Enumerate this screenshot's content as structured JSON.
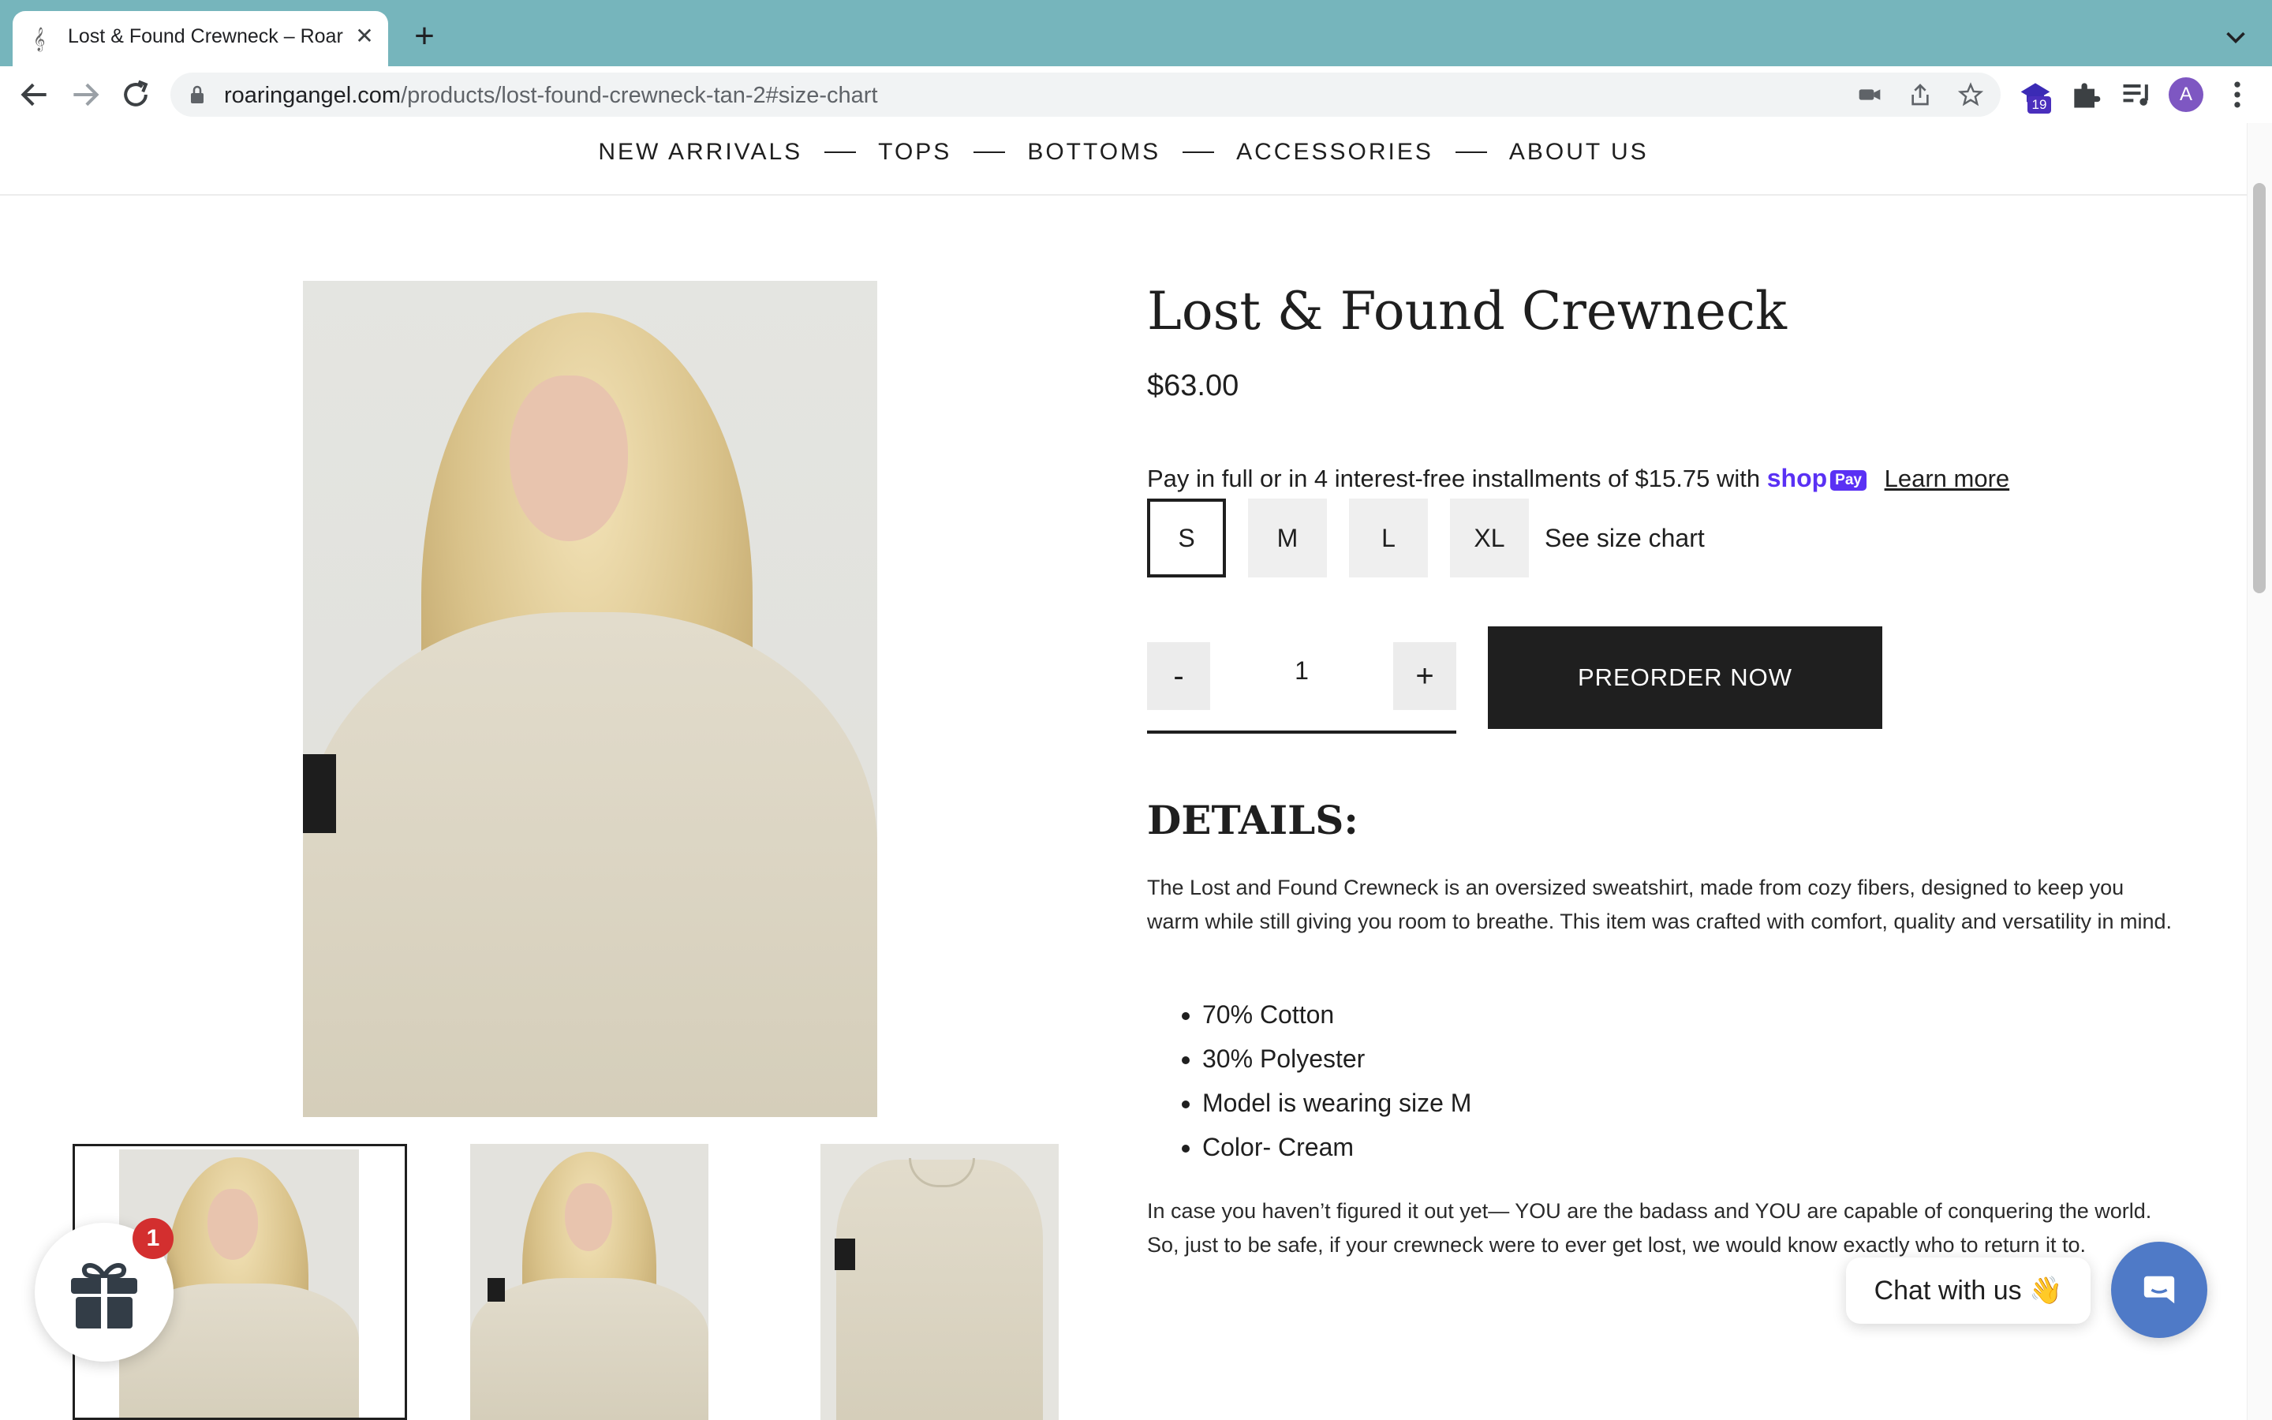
{
  "browser": {
    "tab_title": "Lost & Found Crewneck – Roar",
    "url_host": "roaringangel.com",
    "url_path": "/products/lost-found-crewneck-tan-2#size-chart",
    "extension_badge": "19",
    "profile_initial": "A"
  },
  "nav": {
    "items": [
      "NEW ARRIVALS",
      "TOPS",
      "BOTTOMS",
      "ACCESSORIES",
      "ABOUT US"
    ]
  },
  "product": {
    "title": "Lost & Found Crewneck",
    "price": "$63.00",
    "installment_text": "Pay in full or in 4 interest-free installments of $15.75 with",
    "shop_logo": "shop",
    "shop_pay_pill": "Pay",
    "learn_more": "Learn more",
    "sizes": [
      "S",
      "M",
      "L",
      "XL"
    ],
    "selected_size": "S",
    "size_chart_link": "See size chart",
    "qty_minus": "-",
    "qty_value": "1",
    "qty_plus": "+",
    "preorder_label": "PREORDER NOW",
    "details_heading": "DETAILS:",
    "description": "The Lost and Found Crewneck is an oversized sweatshirt, made from cozy fibers, designed to keep you warm while still giving you room to breathe. This item was crafted with comfort, quality and versatility in mind.",
    "bullets": [
      "70% Cotton",
      "30% Polyester",
      "Model is wearing size M",
      "Color- Cream"
    ],
    "closing": "In case you haven’t figured it out yet— YOU are the badass and YOU are capable of conquering the world. So, just to be safe, if your crewneck were to ever get lost, we would know exactly who to return it to."
  },
  "widgets": {
    "gift_badge": "1",
    "chat_label": "Chat with us 👋"
  },
  "colors": {
    "tab_strip": "#76b5bc",
    "preorder_bg": "#1f1f1f",
    "shop_pay": "#5a31f4",
    "chat_button": "#4f7ac7",
    "gift_badge": "#d32f2f"
  },
  "icons": [
    "back-arrow-icon",
    "forward-arrow-icon",
    "reload-icon",
    "lock-icon",
    "camera-off-icon",
    "share-icon",
    "star-icon",
    "extension-icon",
    "puzzle-icon",
    "media-list-icon",
    "kebab-menu-icon",
    "gift-icon",
    "chat-bubble-icon"
  ]
}
